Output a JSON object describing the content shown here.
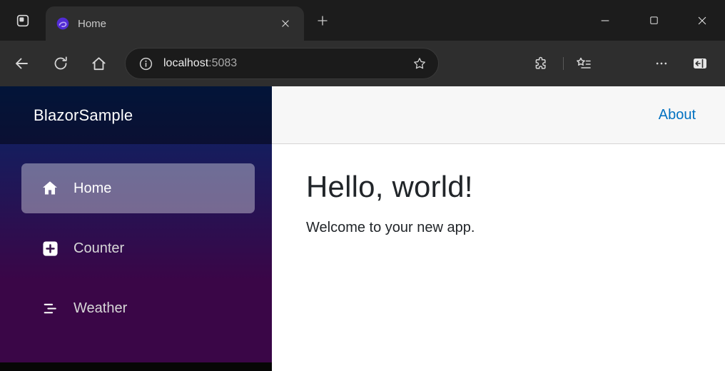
{
  "browser": {
    "tab": {
      "title": "Home"
    },
    "address_bar": {
      "url": "localhost:5083",
      "host": "localhost",
      "port": ":5083"
    },
    "icons": {
      "tab_actions": "tab-actions-icon",
      "favicon": "blazor-logo-icon",
      "tab_close": "close-icon",
      "new_tab": "plus-icon",
      "back": "back-arrow-icon",
      "refresh": "refresh-icon",
      "home": "home-icon",
      "site_info": "info-icon",
      "favorite": "star-icon",
      "extensions": "puzzle-icon",
      "favorites_bar": "star-list-icon",
      "more": "ellipsis-icon",
      "sidebar_toggle": "split-screen-icon",
      "minimize": "minimize-icon",
      "maximize": "maximize-icon",
      "close": "close-icon"
    }
  },
  "app": {
    "brand": "BlazorSample",
    "nav": {
      "items": [
        {
          "label": "Home",
          "icon": "house-icon",
          "active": true
        },
        {
          "label": "Counter",
          "icon": "plus-square-icon",
          "active": false
        },
        {
          "label": "Weather",
          "icon": "list-icon",
          "active": false
        }
      ]
    },
    "header": {
      "about_label": "About"
    },
    "content": {
      "title": "Hello, world!",
      "subtitle": "Welcome to your new app."
    }
  },
  "colors": {
    "link": "#0071c1",
    "sidebar_gradient_top": "#052767",
    "sidebar_gradient_bottom": "#3a0647",
    "active_nav_bg": "rgba(255,255,255,0.37)",
    "topbar_bg": "#f7f7f7"
  }
}
